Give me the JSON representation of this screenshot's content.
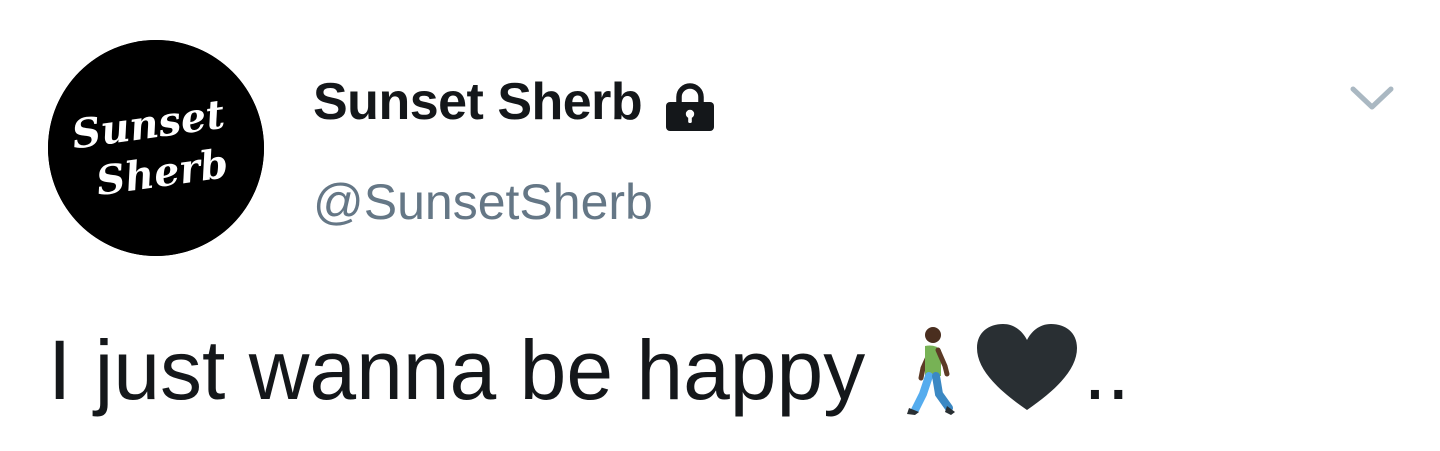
{
  "user": {
    "display_name": "Sunset Sherb",
    "handle": "@SunsetSherb",
    "avatar_text_line1": "Sunset",
    "avatar_text_line2": "Sherb",
    "locked": true,
    "avatar_bg": "#000000"
  },
  "tweet": {
    "text": "I just wanna be happy",
    "emojis": [
      "person-walking-icon",
      "black-heart-icon"
    ],
    "trailing": ".."
  },
  "icons": {
    "lock": "lock-icon",
    "menu": "chevron-down-icon"
  },
  "colors": {
    "text_primary": "#14171a",
    "text_secondary": "#657786",
    "caret": "#aab8c2"
  }
}
